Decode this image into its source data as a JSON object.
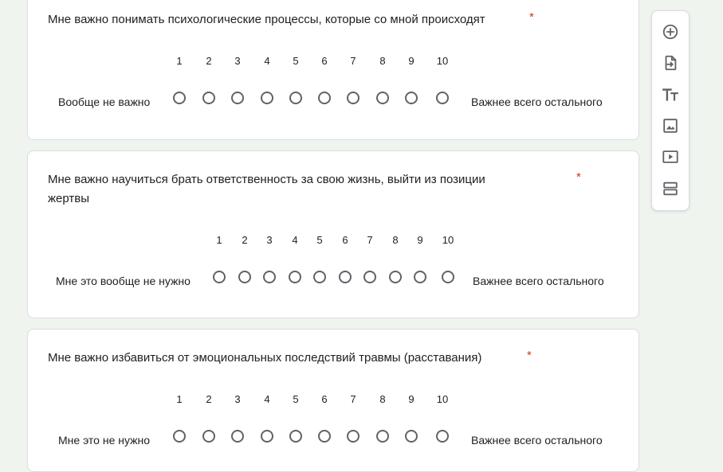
{
  "questions": [
    {
      "text": "Мне важно понимать психологические процессы, которые со мной происходят",
      "required_mark": "*",
      "scale": [
        "1",
        "2",
        "3",
        "4",
        "5",
        "6",
        "7",
        "8",
        "9",
        "10"
      ],
      "min_label": "Вообще не важно",
      "max_label": "Важнее всего остального"
    },
    {
      "text_line1": "Мне важно научиться брать ответственность за свою жизнь,  выйти из позиции",
      "text_line2": "жертвы",
      "required_mark": "*",
      "scale": [
        "1",
        "2",
        "3",
        "4",
        "5",
        "6",
        "7",
        "8",
        "9",
        "10"
      ],
      "min_label": "Мне это вообще не нужно",
      "max_label": "Важнее всего остального"
    },
    {
      "text": "Мне важно избавиться от эмоциональных последствий травмы (расставания)",
      "required_mark": "*",
      "scale": [
        "1",
        "2",
        "3",
        "4",
        "5",
        "6",
        "7",
        "8",
        "9",
        "10"
      ],
      "min_label": "Мне это не нужно",
      "max_label": "Важнее всего остального"
    }
  ],
  "toolbar": {
    "icons": [
      "add-circle-icon",
      "import-questions-icon",
      "title-text-icon",
      "image-icon",
      "video-icon",
      "section-icon"
    ]
  },
  "colors": {
    "background": "#f0f4ef",
    "required": "#d93025",
    "radio_border": "#5f6368",
    "icon": "#5f6368"
  }
}
